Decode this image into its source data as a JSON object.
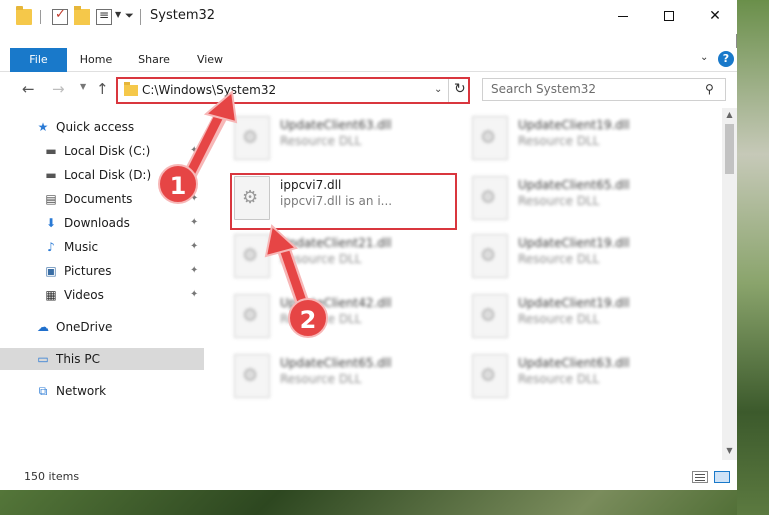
{
  "window": {
    "title": "System32"
  },
  "ribbon": {
    "tabs": [
      {
        "label": "File"
      },
      {
        "label": "Home"
      },
      {
        "label": "Share"
      },
      {
        "label": "View"
      }
    ]
  },
  "address": {
    "path": "C:\\Windows\\System32"
  },
  "search": {
    "placeholder": "Search System32"
  },
  "sidebar": {
    "items": [
      {
        "label": "Quick access",
        "icon": "star-icon"
      },
      {
        "label": "Local Disk (C:)",
        "icon": "drive-icon"
      },
      {
        "label": "Local Disk (D:)",
        "icon": "drive-icon"
      },
      {
        "label": "Documents",
        "icon": "documents-icon"
      },
      {
        "label": "Downloads",
        "icon": "download-arrow-icon"
      },
      {
        "label": "Music",
        "icon": "music-note-icon"
      },
      {
        "label": "Pictures",
        "icon": "pictures-icon"
      },
      {
        "label": "Videos",
        "icon": "film-icon"
      },
      {
        "label": "OneDrive",
        "icon": "cloud-icon"
      },
      {
        "label": "This PC",
        "icon": "monitor-icon"
      },
      {
        "label": "Network",
        "icon": "network-icon"
      }
    ]
  },
  "files": {
    "highlighted": {
      "name": "ippcvi7.dll",
      "description": "ippcvi7.dll is an i..."
    },
    "blurred": [
      {
        "name": "UpdateClient63.dll",
        "description": "Resource DLL"
      },
      {
        "name": "UpdateClient19.dll",
        "description": "Resource DLL"
      },
      {
        "name": "UpdateClient65.dll",
        "description": "Resource DLL"
      },
      {
        "name": "UpdateClient21.dll",
        "description": "Resource DLL"
      },
      {
        "name": "UpdateClient19.dll",
        "description": "Resource DLL"
      },
      {
        "name": "UpdateClient42.dll",
        "description": "Resource DLL"
      },
      {
        "name": "UpdateClient19.dll",
        "description": "Resource DLL"
      },
      {
        "name": "UpdateClient65.dll",
        "description": "Resource DLL"
      },
      {
        "name": "UpdateClient63.dll",
        "description": "Resource DLL"
      }
    ]
  },
  "status": {
    "item_count": "150 items"
  },
  "annotations": {
    "marker_1": "1",
    "marker_2": "2",
    "color": "#e64545"
  },
  "colors": {
    "accent": "#1979ca",
    "highlight_border": "#d9363e"
  }
}
